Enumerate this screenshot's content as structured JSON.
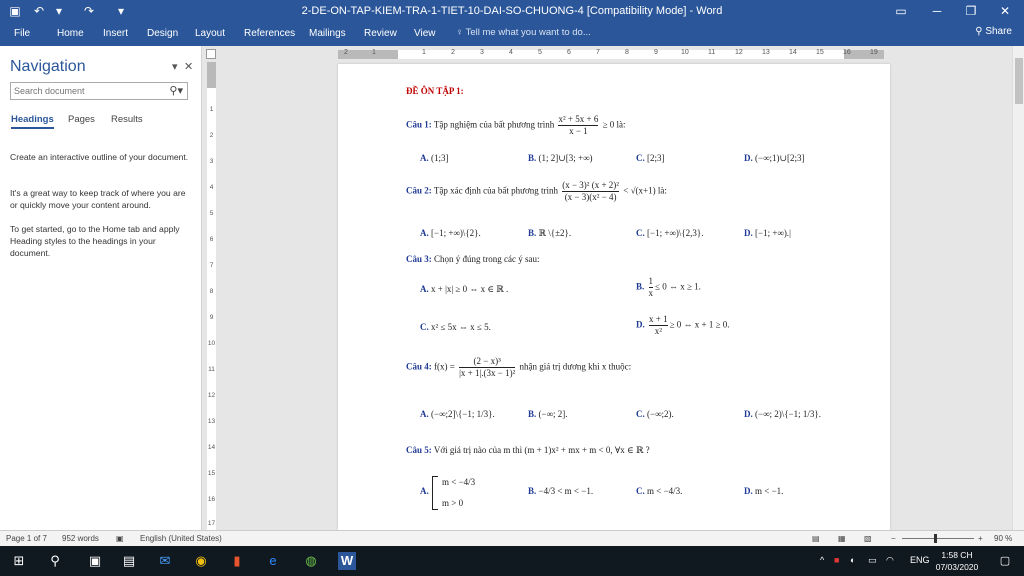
{
  "window": {
    "title": "2-DE-ON-TAP-KIEM-TRA-1-TIET-10-DAI-SO-CHUONG-4 [Compatibility Mode] - Word",
    "save_icon": "save-icon",
    "undo_icon": "undo-icon",
    "redo_icon": "redo-icon"
  },
  "ribbon": {
    "tabs": [
      "File",
      "Home",
      "Insert",
      "Design",
      "Layout",
      "References",
      "Mailings",
      "Review",
      "View"
    ],
    "tell_me": "Tell me what you want to do...",
    "share": "Share"
  },
  "nav": {
    "title": "Navigation",
    "search_placeholder": "Search document",
    "tabs": [
      "Headings",
      "Pages",
      "Results"
    ],
    "paragraphs": [
      "Create an interactive outline of your document.",
      "It's a great way to keep track of where you are or quickly move your content around.",
      "To get started, go to the Home tab and apply Heading styles to the headings in your document."
    ]
  },
  "ruler": {
    "h_ticks": [
      "2",
      "1",
      "1",
      "2",
      "3",
      "4",
      "5",
      "6",
      "7",
      "8",
      "9",
      "10",
      "11",
      "12",
      "13",
      "14",
      "15",
      "16",
      "17",
      "19"
    ],
    "v_ticks": [
      "1",
      "2",
      "3",
      "4",
      "5",
      "6",
      "7",
      "8",
      "9",
      "10",
      "11",
      "12",
      "13",
      "14",
      "15",
      "16",
      "17"
    ]
  },
  "document": {
    "heading": "ĐỀ ÔN TẬP 1:",
    "q1": {
      "label": "Câu 1:",
      "text": "Tập nghiệm của bất phương trình",
      "num": "x² + 5x + 6",
      "den": "x − 1",
      "tail": "≥ 0   là:",
      "options": [
        {
          "key": "A.",
          "value": "(1;3]"
        },
        {
          "key": "B.",
          "value": "(1; 2]∪[3; +∞)"
        },
        {
          "key": "C.",
          "value": "[2;3]"
        },
        {
          "key": "D.",
          "value": "(−∞;1)∪[2;3]"
        }
      ]
    },
    "q2": {
      "label": "Câu 2:",
      "text": "Tập xác định của bất phương trình",
      "num": "(x − 3)² (x + 2)²",
      "den": "(x − 3)(x² − 4)",
      "tail": "< √(x+1)  là:",
      "options": [
        {
          "key": "A.",
          "value": "[−1; +∞)\\{2}."
        },
        {
          "key": "B.",
          "value": "ℝ \\{±2}."
        },
        {
          "key": "C.",
          "value": "[−1; +∞)\\{2,3}."
        },
        {
          "key": "D.",
          "value": "[−1; +∞)."
        }
      ]
    },
    "q3": {
      "label": "Câu 3:",
      "text": "Chọn ý đúng trong các ý sau:",
      "options": [
        {
          "key": "A.",
          "value": "x + |x| ≥ 0 ⇔ x ∈ ℝ ."
        },
        {
          "key": "B.",
          "num": "1",
          "den": "x",
          "value": "≤ 0 ⇔ x ≥ 1."
        },
        {
          "key": "C.",
          "value": "x² ≤ 5x ⇔ x ≤ 5."
        },
        {
          "key": "D.",
          "num": "x + 1",
          "den": "x²",
          "value": "≥ 0 ⇔ x + 1 ≥ 0."
        }
      ]
    },
    "q4": {
      "label": "Câu 4:",
      "prefix": "f(x) =",
      "num": "(2 − x)³",
      "den": "|x + 1|.(3x − 1)²",
      "text": "nhận giá trị dương khi x thuộc:",
      "options": [
        {
          "key": "A.",
          "value": "(−∞;2]\\{−1; 1/3}."
        },
        {
          "key": "B.",
          "value": "(−∞; 2]."
        },
        {
          "key": "C.",
          "value": "(−∞;2)."
        },
        {
          "key": "D.",
          "value": "(−∞; 2)\\{−1; 1/3}."
        }
      ]
    },
    "q5": {
      "label": "Câu 5:",
      "text": "Với giá trị nào của m thì",
      "tail": "(m + 1)x² + mx + m < 0, ∀x ∈ ℝ ?",
      "options": [
        {
          "key": "A.",
          "line1": "m < −4/3",
          "line2": "m > 0"
        },
        {
          "key": "B.",
          "value": "−4/3 < m < −1."
        },
        {
          "key": "C.",
          "value": "m < −4/3."
        },
        {
          "key": "D.",
          "value": "m < −1."
        }
      ]
    }
  },
  "status": {
    "page": "Page 1 of 7",
    "words": "952 words",
    "language": "English (United States)",
    "zoom": "90 %"
  },
  "taskbar": {
    "time": "1:58 CH",
    "date": "07/03/2020",
    "lang": "ENG"
  }
}
